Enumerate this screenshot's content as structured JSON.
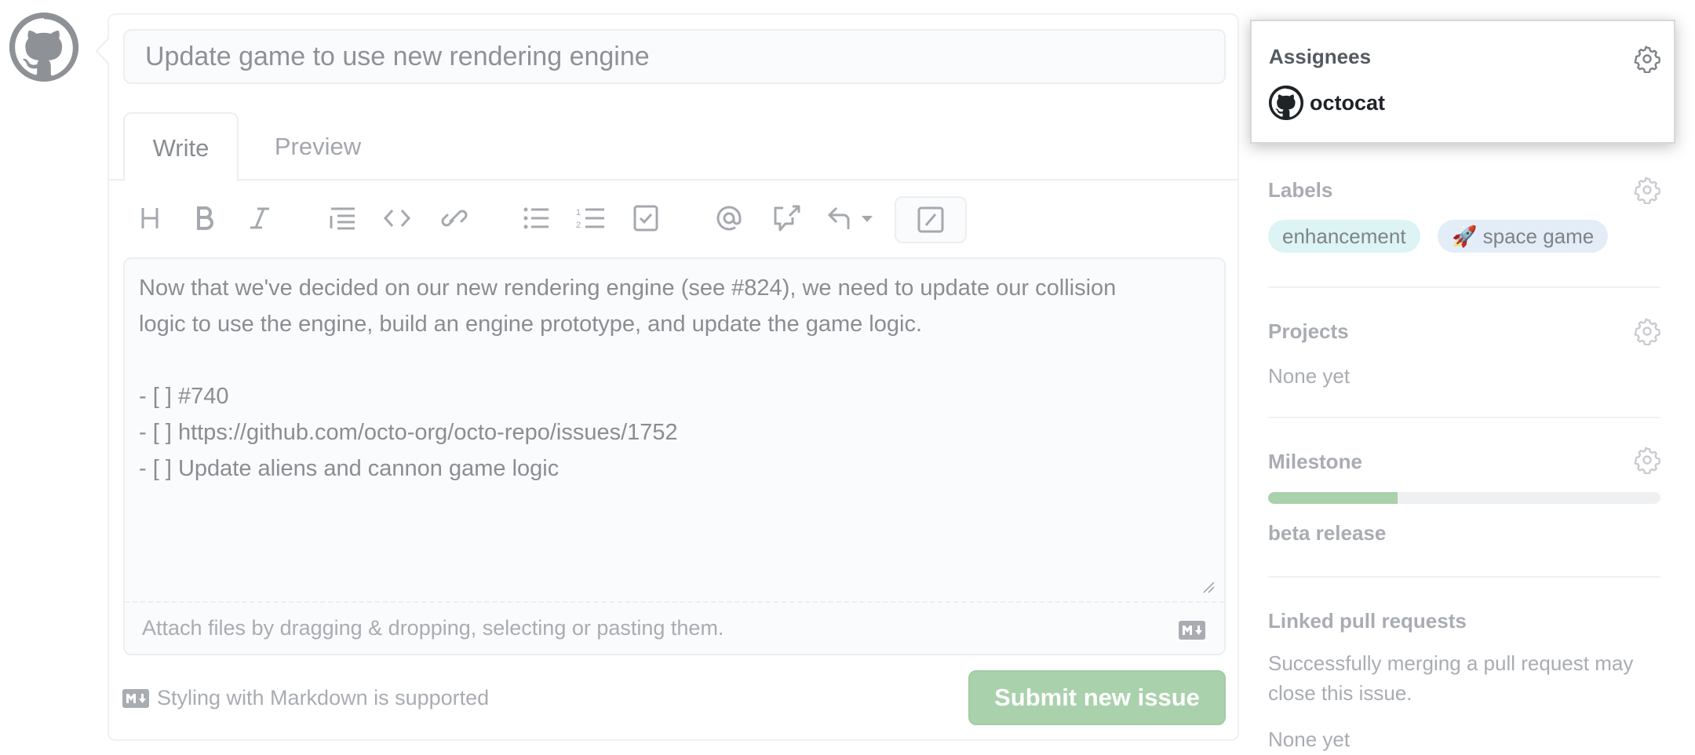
{
  "issue": {
    "title_value": "Update game to use new rendering engine",
    "tabs": [
      {
        "label": "Write",
        "active": true
      },
      {
        "label": "Preview",
        "active": false
      }
    ],
    "toolbar": {
      "icons": [
        "heading-icon",
        "bold-icon",
        "italic-icon",
        "quote-icon",
        "code-icon",
        "link-icon",
        "bulleted-list-icon",
        "numbered-list-icon",
        "task-list-icon",
        "mention-icon",
        "cross-reference-icon",
        "saved-replies-icon",
        "slash-commands-icon"
      ]
    },
    "body_value": "Now that we've decided on our new rendering engine (see #824), we need to update our collision\nlogic to use the engine, build an engine prototype, and update the game logic.\n\n- [ ] #740\n- [ ] https://github.com/octo-org/octo-repo/issues/1752\n- [ ] Update aliens and cannon game logic",
    "attach_text": "Attach files by dragging & dropping, selecting or pasting them.",
    "markdown_note": "Styling with Markdown is supported",
    "submit_label": "Submit new issue"
  },
  "sidebar": {
    "assignees": {
      "heading": "Assignees",
      "users": [
        {
          "name": "octocat"
        }
      ]
    },
    "labels": {
      "heading": "Labels",
      "items": [
        {
          "name": "enhancement",
          "color": "#dcf4f4"
        },
        {
          "emoji": "🚀",
          "name": "space game",
          "color": "#e3edf8"
        }
      ]
    },
    "projects": {
      "heading": "Projects",
      "value": "None yet"
    },
    "milestone": {
      "heading": "Milestone",
      "progress_percent": 33,
      "name": "beta release"
    },
    "linked_pull_requests": {
      "heading": "Linked pull requests",
      "description": "Successfully merging a pull request may close this issue.",
      "value": "None yet"
    }
  },
  "colors": {
    "submit_green": "#a9d1ab",
    "progress_green": "#a9d1ab"
  }
}
